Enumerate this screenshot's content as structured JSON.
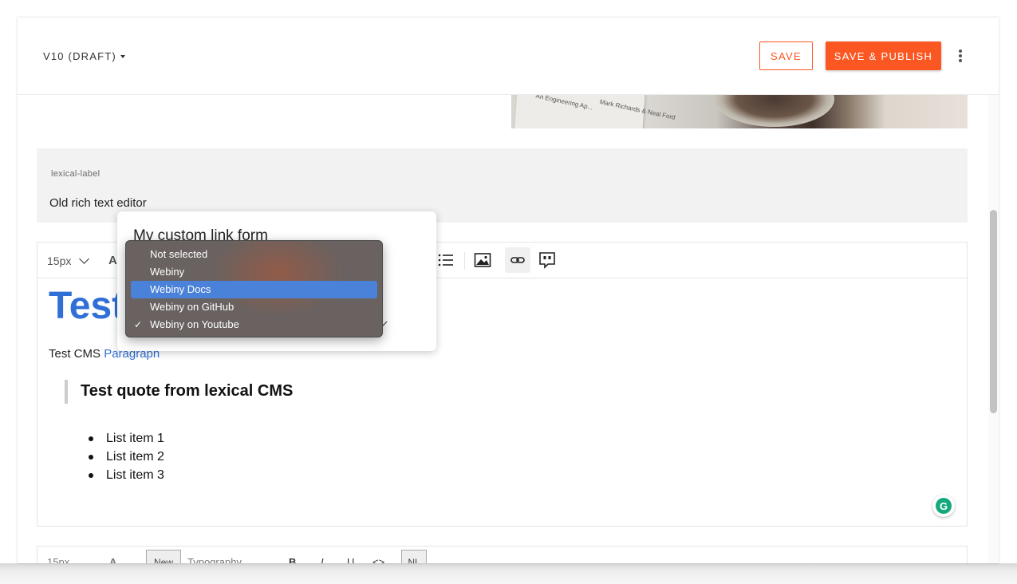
{
  "header": {
    "version_label": "V10 (DRAFT)",
    "save_label": "SAVE",
    "publish_label": "SAVE & PUBLISH"
  },
  "book_image": {
    "text_lines": [
      "An Engineering Ap...",
      "Mark Richards & Neal Ford"
    ]
  },
  "field": {
    "label": "lexical-label",
    "value": "Old rich text editor"
  },
  "toolbar": {
    "font_size": "15px",
    "font_glyph": "A"
  },
  "content": {
    "heading": "Test",
    "paragraph_text": "Test CMS ",
    "paragraph_link": "Paragraph",
    "quote": "Test quote from lexical CMS",
    "list_items": [
      "List item 1",
      "List item 2",
      "List item 3"
    ]
  },
  "toolbar2": {
    "font_size": "15px",
    "font_glyph": "A",
    "new_label": "New",
    "typography_label": "Typography",
    "bold": "B",
    "italic": "I",
    "underline": "U",
    "code": "<>",
    "nl_label": "NL"
  },
  "link_form": {
    "title": "My custom link form",
    "options": [
      {
        "label": "Not selected",
        "highlighted": false,
        "checked": false
      },
      {
        "label": "Webiny",
        "highlighted": false,
        "checked": false
      },
      {
        "label": "Webiny Docs",
        "highlighted": true,
        "checked": false
      },
      {
        "label": "Webiny on GitHub",
        "highlighted": false,
        "checked": false
      },
      {
        "label": "Webiny on Youtube",
        "highlighted": false,
        "checked": true
      }
    ],
    "check_glyph": "✓"
  },
  "grammarly": {
    "glyph": "G"
  },
  "colors": {
    "accent": "#fa5723",
    "link_blue": "#2f6fd6",
    "highlight": "#4b82d9"
  }
}
